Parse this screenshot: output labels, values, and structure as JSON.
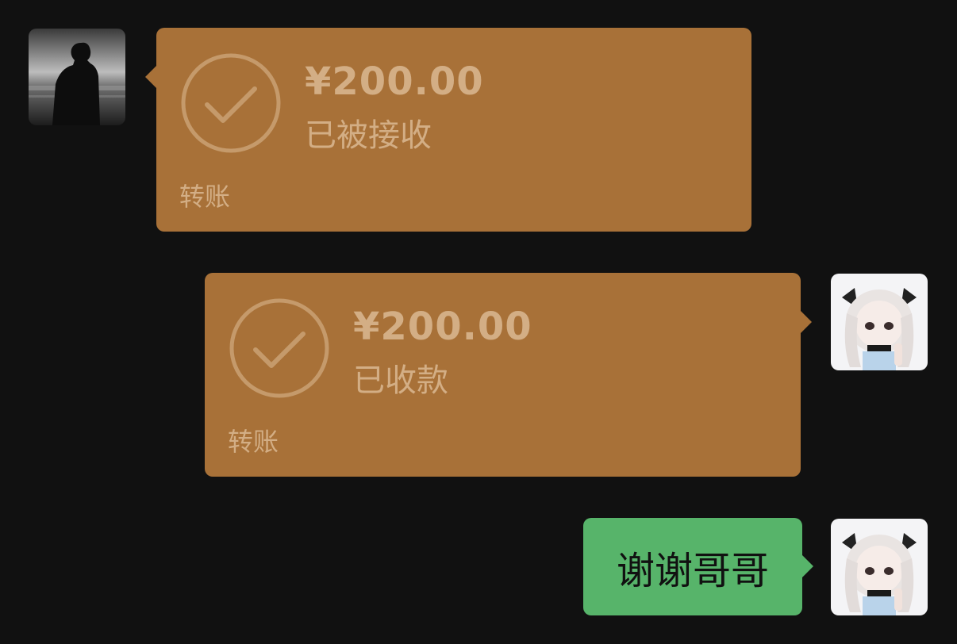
{
  "messages": [
    {
      "side": "left",
      "type": "transfer",
      "amount": "¥200.00",
      "status": "已被接收",
      "label": "转账"
    },
    {
      "side": "right",
      "type": "transfer",
      "amount": "¥200.00",
      "status": "已收款",
      "label": "转账"
    },
    {
      "side": "right",
      "type": "text",
      "text": "谢谢哥哥"
    }
  ],
  "colors": {
    "background": "#111111",
    "transfer_bubble": "#A87138",
    "transfer_text": "#D3AE85",
    "text_bubble": "#57B46A"
  },
  "icons": {
    "transfer_status": "checkmark-circle-icon"
  }
}
